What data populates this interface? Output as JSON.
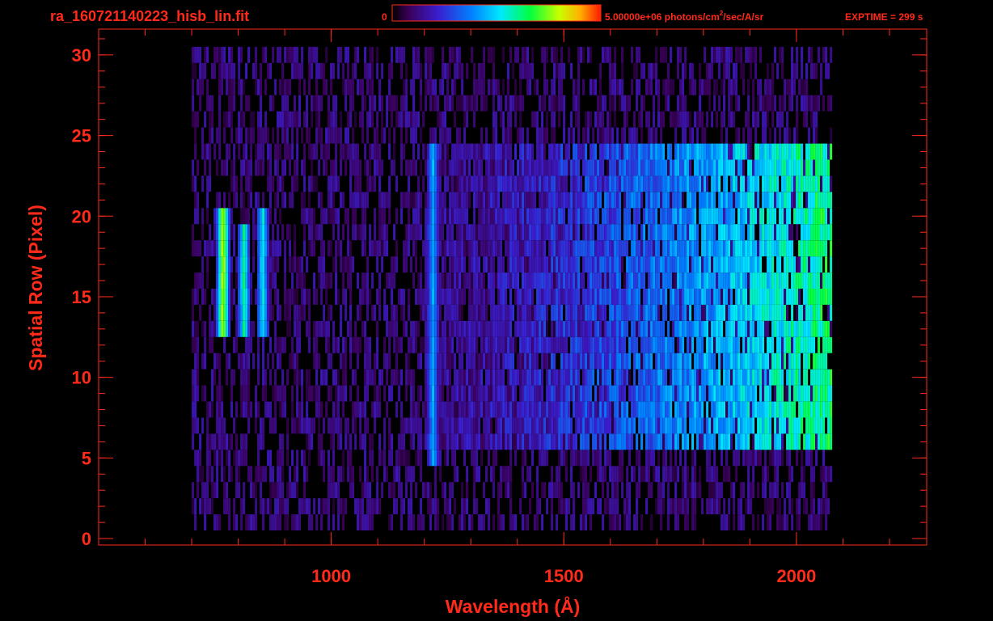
{
  "header": {
    "filename": "ra_160721140223_hisb_lin.fit",
    "colorbar_min_label": "0",
    "colorbar_max_label": "5.00000e+06 photons/cm",
    "colorbar_max_sup": "2",
    "colorbar_max_unit_tail": "/sec/A/sr",
    "exptime_label": "EXPTIME = 299 s"
  },
  "colors": {
    "axis": "#ff2a1a",
    "background": "#000000"
  },
  "chart_data": {
    "type": "heatmap",
    "xlabel": "Wavelength (Å)",
    "ylabel": "Spatial Row (Pixel)",
    "xlim": [
      500,
      2280
    ],
    "ylim": [
      -0.4,
      31.6
    ],
    "x_ticks": [
      1000,
      1500,
      2000
    ],
    "x_tick_labels": [
      "1000",
      "1500",
      "2000"
    ],
    "y_ticks": [
      0,
      5,
      10,
      15,
      20,
      25,
      30
    ],
    "y_tick_labels": [
      "0",
      "5",
      "10",
      "15",
      "20",
      "25",
      "30"
    ],
    "x_minor_step": 100,
    "y_minor_step": 1,
    "colorscale": "rainbow",
    "colorbar_range": [
      0,
      5000000
    ],
    "colorbar_unit": "photons/cm^2/sec/A/sr",
    "data_extent": {
      "x": [
        700,
        2075
      ],
      "y": [
        1,
        30
      ]
    },
    "features": [
      {
        "name": "",
        "x": 765,
        "y_range": [
          13,
          20.5
        ],
        "level": 0.85
      },
      {
        "name": "",
        "x": 810,
        "y_range": [
          13,
          19
        ],
        "level": 0.62
      },
      {
        "name": "",
        "x": 850,
        "y_range": [
          13,
          20
        ],
        "level": 0.55
      },
      {
        "name": "",
        "x": 1216,
        "y_range": [
          5,
          24
        ],
        "level": 0.45
      }
    ],
    "bright_band": {
      "y_range": [
        6,
        24
      ],
      "x_range": [
        1200,
        2070
      ]
    }
  }
}
